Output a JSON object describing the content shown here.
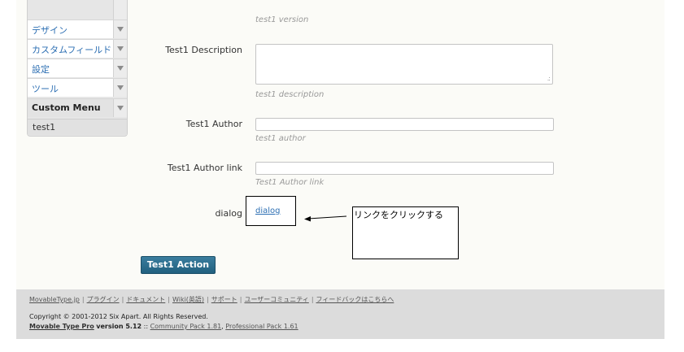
{
  "sidebar": {
    "items": [
      {
        "label": "デザイン"
      },
      {
        "label": "カスタムフィールド"
      },
      {
        "label": "設定"
      },
      {
        "label": "ツール"
      },
      {
        "label": "Custom Menu"
      }
    ],
    "sub_item": "test1"
  },
  "form": {
    "version_hint": "test1 version",
    "description_label": "Test1 Description",
    "description_value": "",
    "description_hint": "test1 description",
    "author_label": "Test1 Author",
    "author_value": "",
    "author_hint": "test1 author",
    "author_link_label": "Test1 Author link",
    "author_link_value": "",
    "author_link_hint": "Test1 Author link",
    "dialog_label": "dialog",
    "dialog_link": "dialog"
  },
  "annotation": {
    "callout_text": "リンクをクリックする"
  },
  "action_button": "Test1 Action",
  "footer": {
    "links": [
      "MovableType.jp",
      "プラグイン",
      "ドキュメント",
      "Wiki(英語)",
      "サポート",
      "ユーザーコミュニティ",
      "フィードバックはこちらへ"
    ],
    "copyright": "Copyright © 2001-2012 Six Apart. All Rights Reserved.",
    "product": "Movable Type Pro",
    "version": "version 5.12",
    "version_sep": "::",
    "pack1": "Community Pack 1.81",
    "pack_sep": ",",
    "pack2": "Professional Pack 1.61"
  }
}
